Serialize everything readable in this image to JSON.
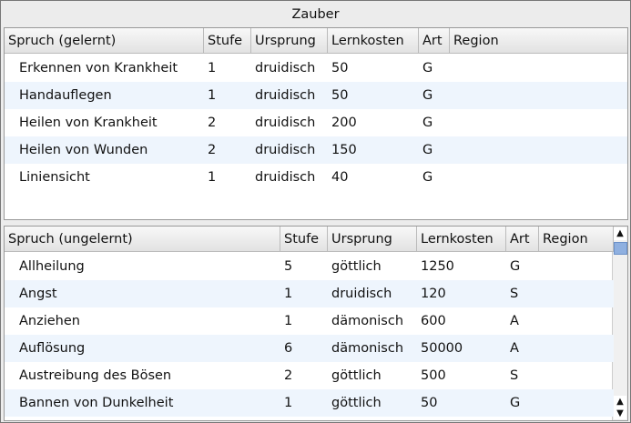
{
  "title": "Zauber",
  "learned": {
    "headers": [
      "Spruch (gelernt)",
      "Stufe",
      "Ursprung",
      "Lernkosten",
      "Art",
      "Region"
    ],
    "rows": [
      [
        "Erkennen von Krankheit",
        "1",
        "druidisch",
        "50",
        "G",
        ""
      ],
      [
        "Handauflegen",
        "1",
        "druidisch",
        "50",
        "G",
        ""
      ],
      [
        "Heilen von Krankheit",
        "2",
        "druidisch",
        "200",
        "G",
        ""
      ],
      [
        "Heilen von Wunden",
        "2",
        "druidisch",
        "150",
        "G",
        ""
      ],
      [
        "Liniensicht",
        "1",
        "druidisch",
        "40",
        "G",
        ""
      ]
    ]
  },
  "unlearned": {
    "headers": [
      "Spruch (ungelernt)",
      "Stufe",
      "Ursprung",
      "Lernkosten",
      "Art",
      "Region"
    ],
    "rows": [
      [
        "Allheilung",
        "5",
        "göttlich",
        "1250",
        "G",
        ""
      ],
      [
        "Angst",
        "1",
        "druidisch",
        "120",
        "S",
        ""
      ],
      [
        "Anziehen",
        "1",
        "dämonisch",
        "600",
        "A",
        ""
      ],
      [
        "Auflösung",
        "6",
        "dämonisch",
        "50000",
        "A",
        ""
      ],
      [
        "Austreibung des Bösen",
        "2",
        "göttlich",
        "500",
        "S",
        ""
      ],
      [
        "Bannen von Dunkelheit",
        "1",
        "göttlich",
        "50",
        "G",
        ""
      ]
    ]
  }
}
